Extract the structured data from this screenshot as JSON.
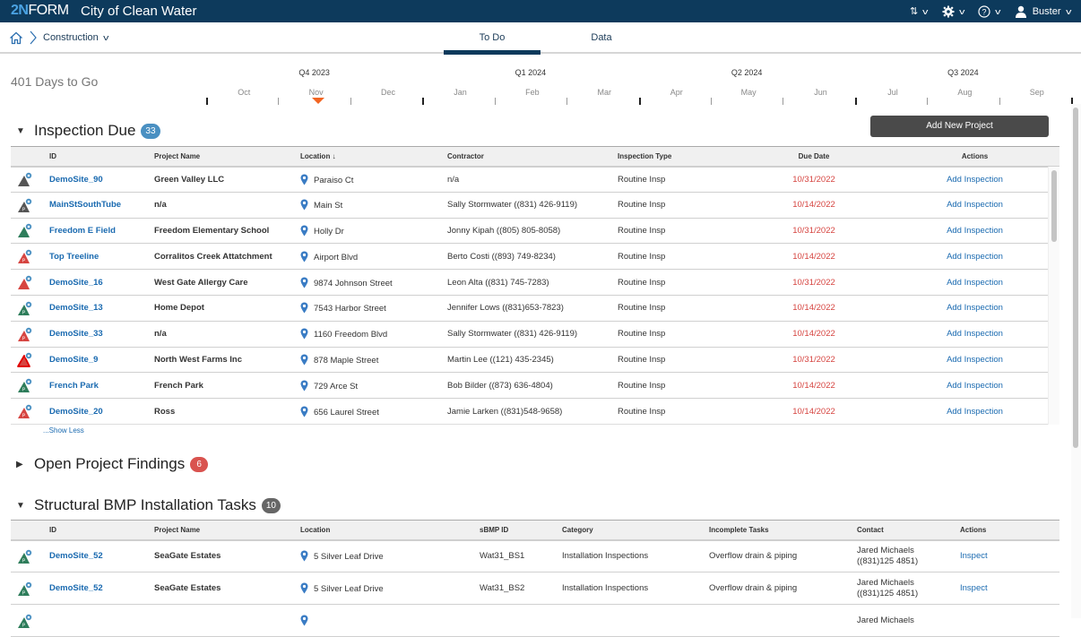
{
  "header": {
    "logo_num": "2N",
    "logo_text": "FORM",
    "app_title": "City of Clean Water",
    "user_name": "Buster"
  },
  "breadcrumb": {
    "current": "Construction"
  },
  "tabs": [
    {
      "label": "To Do",
      "active": true
    },
    {
      "label": "Data",
      "active": false
    }
  ],
  "timeline": {
    "days_to_go": "401 Days to Go",
    "quarters": [
      "Q4 2023",
      "Q1 2024",
      "Q2 2024",
      "Q3 2024"
    ],
    "months": [
      "Oct",
      "Nov",
      "Dec",
      "Jan",
      "Feb",
      "Mar",
      "Apr",
      "May",
      "Jun",
      "Jul",
      "Aug",
      "Sep"
    ],
    "current_month_index": 1
  },
  "colors": {
    "accent": "#0d3a5c",
    "link": "#1a6ab0",
    "overdue": "#d64541",
    "marker": "#f26522"
  },
  "inspection_due": {
    "title": "Inspection Due",
    "count": "33",
    "badge_color": "#4a90c2",
    "add_button": "Add New Project",
    "columns": [
      "ID",
      "Project Name",
      "Location",
      "Contractor",
      "Inspection Type",
      "Due Date",
      "Actions"
    ],
    "sort_indicator": "↓",
    "rows": [
      {
        "id": "DemoSite_90",
        "name": "Green Valley LLC",
        "location": "Paraiso Ct",
        "contractor": "n/a",
        "type": "Routine Insp",
        "due": "10/31/2022",
        "action": "Add Inspection",
        "status": "gray",
        "p": false
      },
      {
        "id": "MainStSouthTube",
        "name": "n/a",
        "location": "Main St",
        "contractor": "Sally Stormwater ((831) 426-9119)",
        "type": "Routine Insp",
        "due": "10/14/2022",
        "action": "Add Inspection",
        "status": "gray",
        "p": true
      },
      {
        "id": "Freedom E Field",
        "name": "Freedom Elementary School",
        "location": "Holly Dr",
        "contractor": "Jonny Kipah ((805) 805-8058)",
        "type": "Routine Insp",
        "due": "10/31/2022",
        "action": "Add Inspection",
        "status": "green",
        "p": false
      },
      {
        "id": "Top Treeline",
        "name": "Corralitos Creek Attatchment",
        "location": "Airport Blvd",
        "contractor": "Berto Costi ((893) 749-8234)",
        "type": "Routine Insp",
        "due": "10/14/2022",
        "action": "Add Inspection",
        "status": "red",
        "p": true
      },
      {
        "id": "DemoSite_16",
        "name": "West Gate Allergy Care",
        "location": "9874 Johnson Street",
        "contractor": "Leon Alta ((831) 745-7283)",
        "type": "Routine Insp",
        "due": "10/31/2022",
        "action": "Add Inspection",
        "status": "red",
        "p": false
      },
      {
        "id": "DemoSite_13",
        "name": "Home Depot",
        "location": "7543 Harbor Street",
        "contractor": "Jennifer Lows ((831)653-7823)",
        "type": "Routine Insp",
        "due": "10/14/2022",
        "action": "Add Inspection",
        "status": "green",
        "p": true
      },
      {
        "id": "DemoSite_33",
        "name": "n/a",
        "location": "1160 Freedom Blvd",
        "contractor": "Sally Stormwater ((831) 426-9119)",
        "type": "Routine Insp",
        "due": "10/14/2022",
        "action": "Add Inspection",
        "status": "red",
        "p": true
      },
      {
        "id": "DemoSite_9",
        "name": "North West Farms Inc",
        "location": "878 Maple Street",
        "contractor": "Martin Lee ((121) 435-2345)",
        "type": "Routine Insp",
        "due": "10/31/2022",
        "action": "Add Inspection",
        "status": "red-outline",
        "p": false
      },
      {
        "id": "French Park",
        "name": "French Park",
        "location": "729 Arce St",
        "contractor": "Bob Bilder ((873) 636-4804)",
        "type": "Routine Insp",
        "due": "10/14/2022",
        "action": "Add Inspection",
        "status": "green",
        "p": true
      },
      {
        "id": "DemoSite_20",
        "name": "Ross",
        "location": "656 Laurel Street",
        "contractor": "Jamie Larken ((831)548-9658)",
        "type": "Routine Insp",
        "due": "10/14/2022",
        "action": "Add Inspection",
        "status": "red",
        "p": true
      }
    ],
    "show_less": "...Show Less"
  },
  "open_findings": {
    "title": "Open Project Findings",
    "count": "6",
    "badge_color": "#d9534f"
  },
  "bmp_tasks": {
    "title": "Structural BMP Installation Tasks",
    "count": "10",
    "badge_color": "#666666",
    "columns": [
      "ID",
      "Project Name",
      "Location",
      "sBMP ID",
      "Category",
      "Incomplete Tasks",
      "Contact",
      "Actions"
    ],
    "rows": [
      {
        "id": "DemoSite_52",
        "name": "SeaGate Estates",
        "location": "5 Silver Leaf Drive",
        "sbmp": "Wat31_BS1",
        "category": "Installation Inspections",
        "tasks": "Overflow drain & piping",
        "contact_name": "Jared Michaels",
        "contact_phone": "((831)125 4851)",
        "action": "Inspect"
      },
      {
        "id": "DemoSite_52",
        "name": "SeaGate Estates",
        "location": "5 Silver Leaf Drive",
        "sbmp": "Wat31_BS2",
        "category": "Installation Inspections",
        "tasks": "Overflow drain & piping",
        "contact_name": "Jared Michaels",
        "contact_phone": "((831)125 4851)",
        "action": "Inspect"
      },
      {
        "id": "",
        "name": "",
        "location": "",
        "sbmp": "",
        "category": "",
        "tasks": "",
        "contact_name": "Jared Michaels",
        "contact_phone": "",
        "action": ""
      }
    ]
  }
}
